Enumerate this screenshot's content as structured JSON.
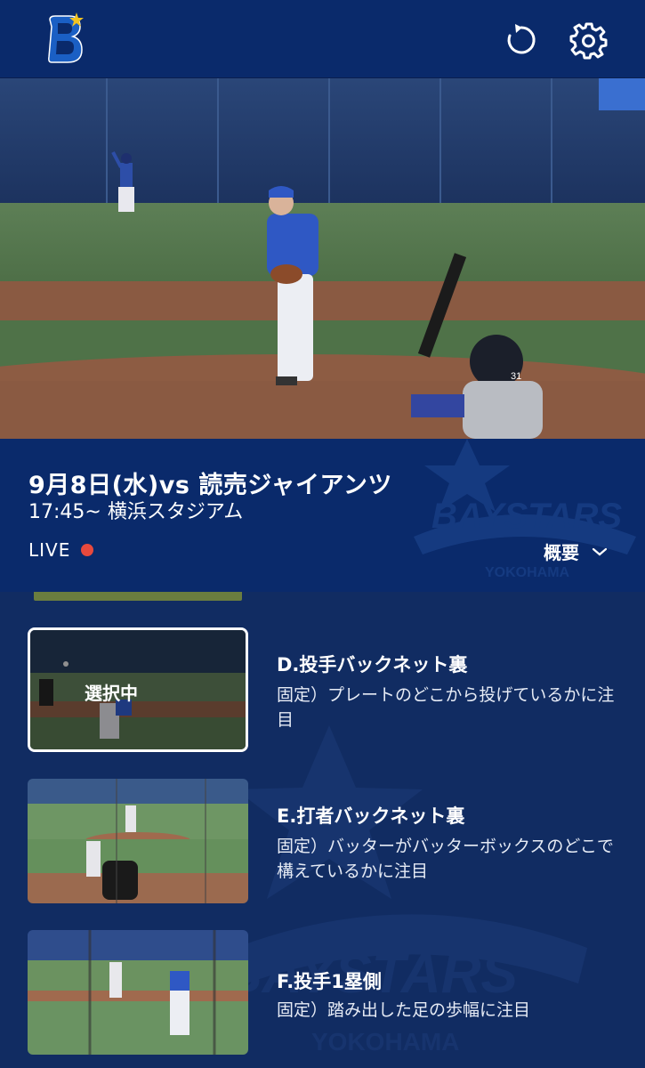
{
  "header": {
    "logo_icon": "baystars-b-logo-icon",
    "reload_icon": "reload-icon",
    "settings_icon": "gear-icon"
  },
  "video": {
    "scoreboard_tag": "31"
  },
  "game": {
    "title": "9月8日(水)vs 読売ジャイアンツ",
    "time_venue": "17:45~ 横浜スタジアム",
    "live_label": "LIVE",
    "live_color": "#e8493d",
    "summary_label": "概要",
    "summary_icon": "chevron-down-icon"
  },
  "cameras": [
    {
      "title": "D.投手バックネット裏",
      "description": "固定）プレートのどこから投げているかに注目",
      "selected": true,
      "selected_label": "選択中"
    },
    {
      "title": "E.打者バックネット裏",
      "description": "固定）バッターがバッターボックスのどこで構えているかに注目",
      "selected": false
    },
    {
      "title": "F.投手1塁側",
      "description": "固定）踏み出した足の歩幅に注目",
      "selected": false
    }
  ],
  "colors": {
    "background": "#0d2b66",
    "header": "#0a2a6b",
    "list_background": "#112c62",
    "accent_yellow": "#f2c320"
  }
}
